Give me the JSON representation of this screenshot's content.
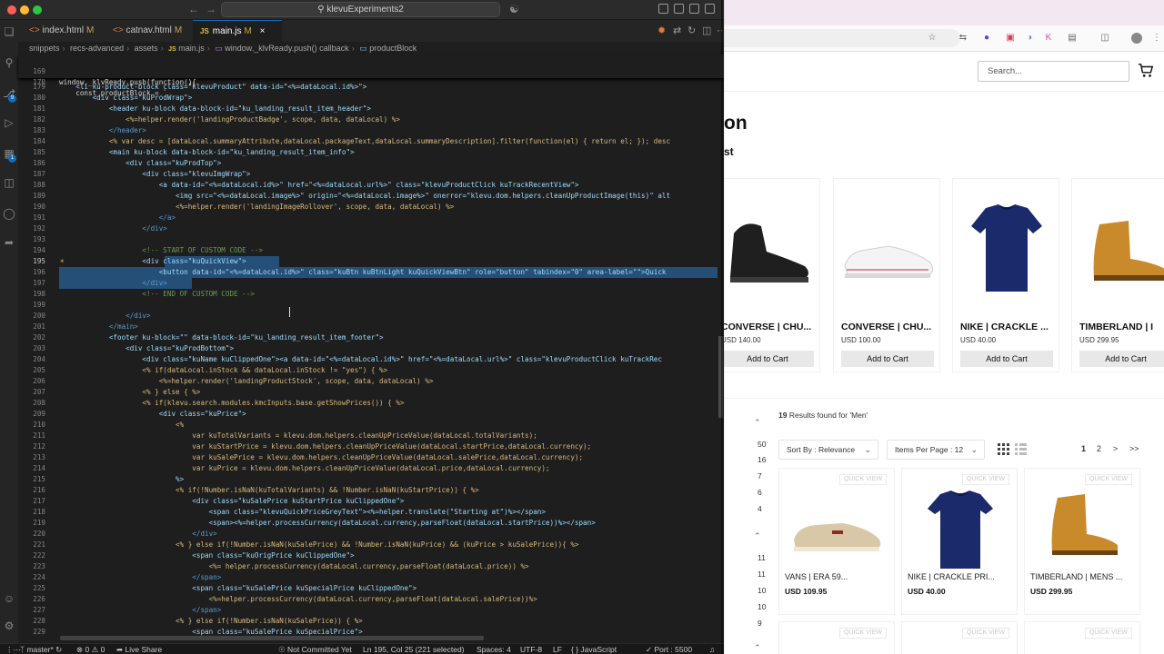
{
  "vscode": {
    "title": "klevuExperiments2",
    "tabs": [
      {
        "label": "index.html",
        "modified": "M"
      },
      {
        "label": "catnav.html",
        "modified": "M"
      },
      {
        "label": "main.js",
        "modified": "M",
        "icon": "JS"
      }
    ],
    "breadcrumb": [
      "snippets",
      "recs-advanced",
      "assets",
      "main.js",
      "window._klvReady.push() callback",
      "productBlock"
    ],
    "sticky_lines": [
      {
        "num": "169",
        "text": "window._klvReady.push(function(){"
      },
      {
        "num": "170",
        "text": "    const productBlock = `"
      }
    ],
    "lines": [
      {
        "num": "179",
        "text": "    <li ku-product-block class=\"klevuProduct\" data-id=\"<%=dataLocal.id%>\">"
      },
      {
        "num": "180",
        "text": "        <div class=\"kuProdWrap\">"
      },
      {
        "num": "181",
        "text": "            <header ku-block data-block-id=\"ku_landing_result_item_header\">"
      },
      {
        "num": "182",
        "text": "                <%=helper.render('landingProductBadge', scope, data, dataLocal) %>"
      },
      {
        "num": "183",
        "text": "            </header>"
      },
      {
        "num": "184",
        "text": "            <% var desc = [dataLocal.summaryAttribute,dataLocal.packageText,dataLocal.summaryDescription].filter(function(el) { return el; }); desc"
      },
      {
        "num": "185",
        "text": "            <main ku-block data-block-id=\"ku_landing_result_item_info\">"
      },
      {
        "num": "186",
        "text": "                <div class=\"kuProdTop\">"
      },
      {
        "num": "187",
        "text": "                    <div class=\"klevuImgWrap\">"
      },
      {
        "num": "188",
        "text": "                        <a data-id=\"<%=dataLocal.id%>\" href=\"<%=dataLocal.url%>\" class=\"klevuProductClick kuTrackRecentView\">"
      },
      {
        "num": "189",
        "text": "                            <img src=\"<%=dataLocal.image%>\" origin=\"<%=dataLocal.image%>\" onerror=\"klevu.dom.helpers.cleanUpProductImage(this)\" alt"
      },
      {
        "num": "190",
        "text": "                            <%=helper.render('landingImageRollover', scope, data, dataLocal) %>"
      },
      {
        "num": "191",
        "text": "                        </a>"
      },
      {
        "num": "192",
        "text": "                    </div>"
      },
      {
        "num": "193",
        "text": ""
      },
      {
        "num": "194",
        "text": "                    <!-- START OF CUSTOM CODE -->"
      },
      {
        "num": "195",
        "text": "                    <div class=\"kuQuickView\">"
      },
      {
        "num": "196",
        "text": "                        <button data-id=\"<%=dataLocal.id%>\" class=\"kuBtn kuBtnLight kuQuickViewBtn\" role=\"button\" tabindex=\"0\" area-label=\"\">Quick"
      },
      {
        "num": "197",
        "text": "                    </div>"
      },
      {
        "num": "198",
        "text": "                    <!-- END OF CUSTOM CODE -->"
      },
      {
        "num": "199",
        "text": ""
      },
      {
        "num": "200",
        "text": "                </div>"
      },
      {
        "num": "201",
        "text": "            </main>"
      },
      {
        "num": "202",
        "text": "            <footer ku-block=\"\" data-block-id=\"ku_landing_result_item_footer\">"
      },
      {
        "num": "203",
        "text": "                <div class=\"kuProdBottom\">"
      },
      {
        "num": "204",
        "text": "                    <div class=\"kuName kuClippedOne\"><a data-id=\"<%=dataLocal.id%>\" href=\"<%=dataLocal.url%>\" class=\"klevuProductClick kuTrackRec"
      },
      {
        "num": "205",
        "text": "                    <% if(dataLocal.inStock && dataLocal.inStock != \"yes\") { %>"
      },
      {
        "num": "206",
        "text": "                        <%=helper.render('landingProductStock', scope, data, dataLocal) %>"
      },
      {
        "num": "207",
        "text": "                    <% } else { %>"
      },
      {
        "num": "208",
        "text": "                    <% if(klevu.search.modules.kmcInputs.base.getShowPrices()) { %>"
      },
      {
        "num": "209",
        "text": "                        <div class=\"kuPrice\">"
      },
      {
        "num": "210",
        "text": "                            <%"
      },
      {
        "num": "211",
        "text": "                                var kuTotalVariants = klevu.dom.helpers.cleanUpPriceValue(dataLocal.totalVariants);"
      },
      {
        "num": "212",
        "text": "                                var kuStartPrice = klevu.dom.helpers.cleanUpPriceValue(dataLocal.startPrice,dataLocal.currency);"
      },
      {
        "num": "213",
        "text": "                                var kuSalePrice = klevu.dom.helpers.cleanUpPriceValue(dataLocal.salePrice,dataLocal.currency);"
      },
      {
        "num": "214",
        "text": "                                var kuPrice = klevu.dom.helpers.cleanUpPriceValue(dataLocal.price,dataLocal.currency);"
      },
      {
        "num": "215",
        "text": "                            %>"
      },
      {
        "num": "216",
        "text": "                            <% if(!Number.isNaN(kuTotalVariants) && !Number.isNaN(kuStartPrice)) { %>"
      },
      {
        "num": "217",
        "text": "                                <div class=\"kuSalePrice kuStartPrice kuClippedOne\">"
      },
      {
        "num": "218",
        "text": "                                    <span class=\"klevuQuickPriceGreyText\"><%=helper.translate(\"Starting at\")%></span>"
      },
      {
        "num": "219",
        "text": "                                    <span><%=helper.processCurrency(dataLocal.currency,parseFloat(dataLocal.startPrice))%></span>"
      },
      {
        "num": "220",
        "text": "                                </div>"
      },
      {
        "num": "221",
        "text": "                            <% } else if(!Number.isNaN(kuSalePrice) && !Number.isNaN(kuPrice) && (kuPrice > kuSalePrice)){ %>"
      },
      {
        "num": "222",
        "text": "                                <span class=\"kuOrigPrice kuClippedOne\">"
      },
      {
        "num": "223",
        "text": "                                    <%= helper.processCurrency(dataLocal.currency,parseFloat(dataLocal.price)) %>"
      },
      {
        "num": "224",
        "text": "                                </span>"
      },
      {
        "num": "225",
        "text": "                                <span class=\"kuSalePrice kuSpecialPrice kuClippedOne\">"
      },
      {
        "num": "226",
        "text": "                                    <%=helper.processCurrency(dataLocal.currency,parseFloat(dataLocal.salePrice))%>"
      },
      {
        "num": "227",
        "text": "                                </span>"
      },
      {
        "num": "228",
        "text": "                            <% } else if(!Number.isNaN(kuSalePrice)) { %>"
      },
      {
        "num": "229",
        "text": "                                <span class=\"kuSalePrice kuSpecialPrice\">"
      }
    ],
    "status": {
      "branch": "master*",
      "errors": "0",
      "warnings": "0",
      "live_share": "Live Share",
      "commit": "Not Committed Yet",
      "position": "Ln 195, Col 25 (221 selected)",
      "spaces": "Spaces: 4",
      "encoding": "UTF-8",
      "eol": "LF",
      "language": "JavaScript",
      "port": "Port : 5500"
    }
  },
  "browser": {
    "search_placeholder": "Search...",
    "hero_title": "on",
    "hero_subtitle": "st",
    "recommendations": [
      {
        "name": "CONVERSE | CHU...",
        "price": "USD 140.00",
        "button": "Add to Cart",
        "image": "black-hightop-sneaker"
      },
      {
        "name": "CONVERSE | CHU...",
        "price": "USD 100.00",
        "button": "Add to Cart",
        "image": "white-lowtop-sneaker"
      },
      {
        "name": "NIKE | CRACKLE ...",
        "price": "USD 40.00",
        "button": "Add to Cart",
        "image": "navy-tshirt"
      },
      {
        "name": "TIMBERLAND | I",
        "price": "USD 299.95",
        "button": "Add to Cart",
        "image": "tan-boot"
      }
    ],
    "results": {
      "count": "19",
      "text": "Results found for 'Men'"
    },
    "sort_label": "Sort By : Relevance",
    "items_per_page": "Items Per Page : 12",
    "pagination": [
      "1",
      "2",
      ">",
      ">>"
    ],
    "facet_counts_a": [
      "50",
      "16",
      "7",
      "6",
      "4"
    ],
    "facet_counts_b": [
      "11",
      "11",
      "10",
      "10",
      "9"
    ],
    "quick_view": "QUICK VIEW",
    "grid": [
      {
        "name": "VANS | ERA 59...",
        "price": "USD 109.95",
        "image": "beige-sneaker"
      },
      {
        "name": "NIKE | CRACKLE PRI...",
        "price": "USD 40.00",
        "image": "navy-tshirt"
      },
      {
        "name": "TIMBERLAND | MENS ...",
        "price": "USD 299.95",
        "image": "tan-boot"
      }
    ],
    "colors": {
      "accent": "#0d6ebd",
      "selection": "#264f78"
    }
  }
}
